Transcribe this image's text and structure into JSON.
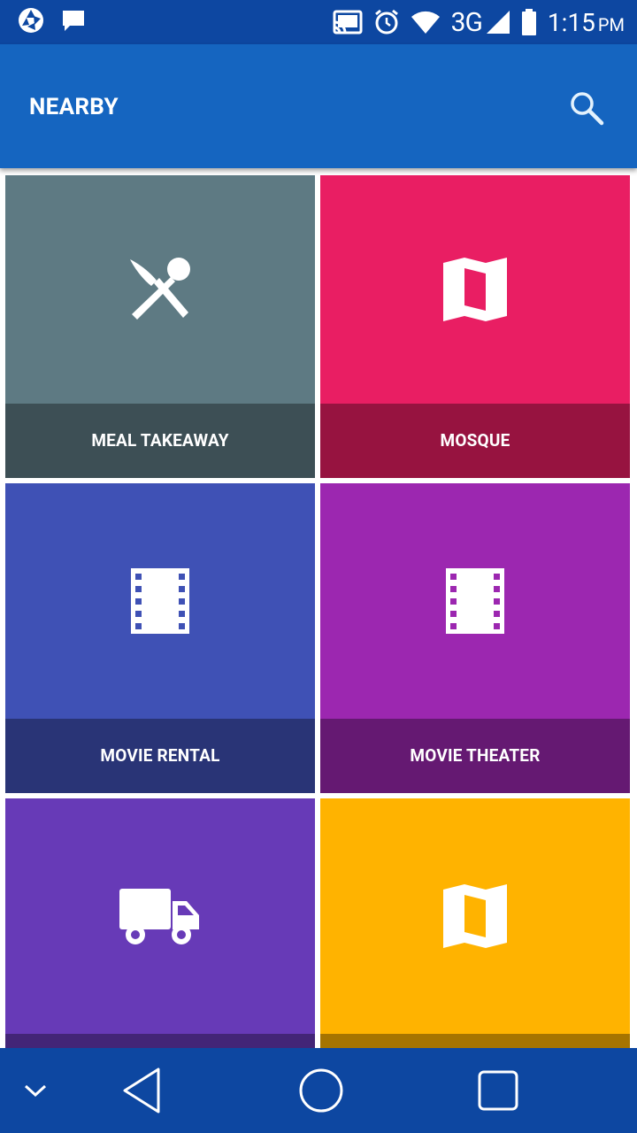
{
  "status_bar": {
    "network": "3G",
    "time": "1:15",
    "ampm": "PM",
    "icons": [
      "aperture-icon",
      "chat-icon",
      "cast-icon",
      "alarm-icon",
      "wifi-icon",
      "signal-icon",
      "battery-icon"
    ]
  },
  "app_bar": {
    "title": "NEARBY",
    "search_icon": "search-icon"
  },
  "tiles": [
    {
      "label": "MEAL TAKEAWAY",
      "icon": "restaurant-icon",
      "color": "#5e7a83"
    },
    {
      "label": "MOSQUE",
      "icon": "map-icon",
      "color": "#e91e63"
    },
    {
      "label": "MOVIE RENTAL",
      "icon": "film-icon",
      "color": "#3f51b5"
    },
    {
      "label": "MOVIE THEATER",
      "icon": "film-icon",
      "color": "#9c27b0"
    },
    {
      "label": "",
      "icon": "truck-icon",
      "color": "#673ab7"
    },
    {
      "label": "",
      "icon": "map-icon",
      "color": "#ffb300"
    }
  ],
  "nav_bar": {
    "items": [
      "chevron-down-icon",
      "back-icon",
      "home-icon",
      "recents-icon"
    ]
  }
}
